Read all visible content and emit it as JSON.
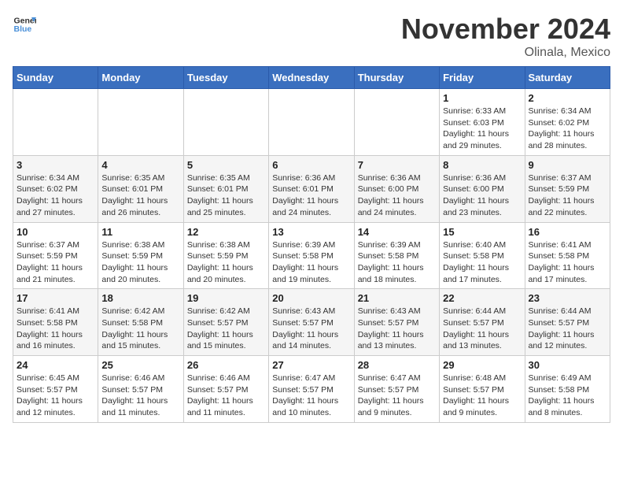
{
  "logo": {
    "text_general": "General",
    "text_blue": "Blue"
  },
  "title": "November 2024",
  "subtitle": "Olinala, Mexico",
  "days_of_week": [
    "Sunday",
    "Monday",
    "Tuesday",
    "Wednesday",
    "Thursday",
    "Friday",
    "Saturday"
  ],
  "weeks": [
    [
      {
        "day": "",
        "info": ""
      },
      {
        "day": "",
        "info": ""
      },
      {
        "day": "",
        "info": ""
      },
      {
        "day": "",
        "info": ""
      },
      {
        "day": "",
        "info": ""
      },
      {
        "day": "1",
        "info": "Sunrise: 6:33 AM\nSunset: 6:03 PM\nDaylight: 11 hours and 29 minutes."
      },
      {
        "day": "2",
        "info": "Sunrise: 6:34 AM\nSunset: 6:02 PM\nDaylight: 11 hours and 28 minutes."
      }
    ],
    [
      {
        "day": "3",
        "info": "Sunrise: 6:34 AM\nSunset: 6:02 PM\nDaylight: 11 hours and 27 minutes."
      },
      {
        "day": "4",
        "info": "Sunrise: 6:35 AM\nSunset: 6:01 PM\nDaylight: 11 hours and 26 minutes."
      },
      {
        "day": "5",
        "info": "Sunrise: 6:35 AM\nSunset: 6:01 PM\nDaylight: 11 hours and 25 minutes."
      },
      {
        "day": "6",
        "info": "Sunrise: 6:36 AM\nSunset: 6:01 PM\nDaylight: 11 hours and 24 minutes."
      },
      {
        "day": "7",
        "info": "Sunrise: 6:36 AM\nSunset: 6:00 PM\nDaylight: 11 hours and 24 minutes."
      },
      {
        "day": "8",
        "info": "Sunrise: 6:36 AM\nSunset: 6:00 PM\nDaylight: 11 hours and 23 minutes."
      },
      {
        "day": "9",
        "info": "Sunrise: 6:37 AM\nSunset: 5:59 PM\nDaylight: 11 hours and 22 minutes."
      }
    ],
    [
      {
        "day": "10",
        "info": "Sunrise: 6:37 AM\nSunset: 5:59 PM\nDaylight: 11 hours and 21 minutes."
      },
      {
        "day": "11",
        "info": "Sunrise: 6:38 AM\nSunset: 5:59 PM\nDaylight: 11 hours and 20 minutes."
      },
      {
        "day": "12",
        "info": "Sunrise: 6:38 AM\nSunset: 5:59 PM\nDaylight: 11 hours and 20 minutes."
      },
      {
        "day": "13",
        "info": "Sunrise: 6:39 AM\nSunset: 5:58 PM\nDaylight: 11 hours and 19 minutes."
      },
      {
        "day": "14",
        "info": "Sunrise: 6:39 AM\nSunset: 5:58 PM\nDaylight: 11 hours and 18 minutes."
      },
      {
        "day": "15",
        "info": "Sunrise: 6:40 AM\nSunset: 5:58 PM\nDaylight: 11 hours and 17 minutes."
      },
      {
        "day": "16",
        "info": "Sunrise: 6:41 AM\nSunset: 5:58 PM\nDaylight: 11 hours and 17 minutes."
      }
    ],
    [
      {
        "day": "17",
        "info": "Sunrise: 6:41 AM\nSunset: 5:58 PM\nDaylight: 11 hours and 16 minutes."
      },
      {
        "day": "18",
        "info": "Sunrise: 6:42 AM\nSunset: 5:58 PM\nDaylight: 11 hours and 15 minutes."
      },
      {
        "day": "19",
        "info": "Sunrise: 6:42 AM\nSunset: 5:57 PM\nDaylight: 11 hours and 15 minutes."
      },
      {
        "day": "20",
        "info": "Sunrise: 6:43 AM\nSunset: 5:57 PM\nDaylight: 11 hours and 14 minutes."
      },
      {
        "day": "21",
        "info": "Sunrise: 6:43 AM\nSunset: 5:57 PM\nDaylight: 11 hours and 13 minutes."
      },
      {
        "day": "22",
        "info": "Sunrise: 6:44 AM\nSunset: 5:57 PM\nDaylight: 11 hours and 13 minutes."
      },
      {
        "day": "23",
        "info": "Sunrise: 6:44 AM\nSunset: 5:57 PM\nDaylight: 11 hours and 12 minutes."
      }
    ],
    [
      {
        "day": "24",
        "info": "Sunrise: 6:45 AM\nSunset: 5:57 PM\nDaylight: 11 hours and 12 minutes."
      },
      {
        "day": "25",
        "info": "Sunrise: 6:46 AM\nSunset: 5:57 PM\nDaylight: 11 hours and 11 minutes."
      },
      {
        "day": "26",
        "info": "Sunrise: 6:46 AM\nSunset: 5:57 PM\nDaylight: 11 hours and 11 minutes."
      },
      {
        "day": "27",
        "info": "Sunrise: 6:47 AM\nSunset: 5:57 PM\nDaylight: 11 hours and 10 minutes."
      },
      {
        "day": "28",
        "info": "Sunrise: 6:47 AM\nSunset: 5:57 PM\nDaylight: 11 hours and 9 minutes."
      },
      {
        "day": "29",
        "info": "Sunrise: 6:48 AM\nSunset: 5:57 PM\nDaylight: 11 hours and 9 minutes."
      },
      {
        "day": "30",
        "info": "Sunrise: 6:49 AM\nSunset: 5:58 PM\nDaylight: 11 hours and 8 minutes."
      }
    ]
  ]
}
